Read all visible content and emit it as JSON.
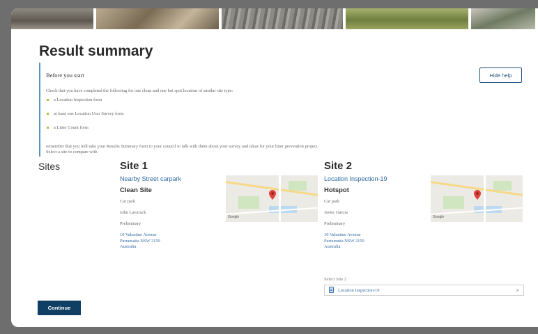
{
  "page": {
    "title": "Result summary"
  },
  "help": {
    "heading": "Before you start",
    "intro": "Check that you have completed the following for one clean and one hot spot location of similar site type:",
    "items": [
      "a Location Inspection form",
      "at least one Location User Survey form",
      "a Litter Count form"
    ],
    "outro_1": "remember that you will take your Results Summary form to your council to talk with them about your survey and ideas for your litter prevention project.",
    "outro_2": "Select a site to compare with",
    "hide_label": "Hide help"
  },
  "sites": {
    "label": "Sites",
    "site1": {
      "heading": "Site 1",
      "name": "Nearby Street carpark",
      "type": "Clean Site",
      "category": "Car park",
      "person": "John Lavarack",
      "status": "Preliminary",
      "address": [
        "10 Valentine Avenue",
        "Parramatta NSW 2150",
        "Australia"
      ]
    },
    "site2": {
      "heading": "Site 2",
      "name": "Location Inspection-19",
      "type": "Hotspot",
      "category": "Car park",
      "person": "Javier Garcia",
      "status": "Preliminary",
      "address": [
        "10 Valentine Avenue",
        "Parramatta NSW 2150",
        "Australia"
      ]
    },
    "map_logo": "Google"
  },
  "select": {
    "label": "Select Site 2",
    "value": "Location Inspection-19",
    "clear": "×"
  },
  "actions": {
    "continue_label": "Continue"
  },
  "colors": {
    "primary": "#0f3f63",
    "link": "#2f6aa3",
    "accent_bullet": "#a9c23f",
    "pin": "#e0403a"
  },
  "icons": {
    "map_pin": "map-pin-icon",
    "doc": "document-icon",
    "clear": "clear-icon"
  }
}
